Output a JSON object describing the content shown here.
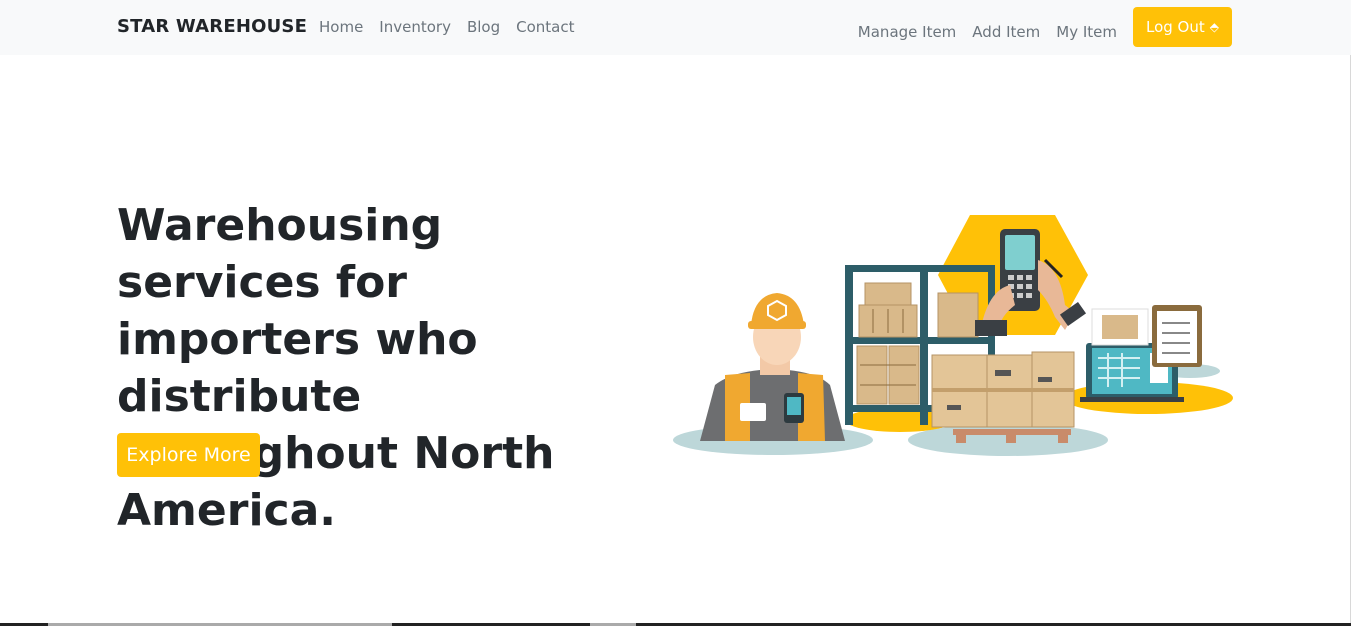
{
  "nav": {
    "brand": "STAR WAREHOUSE",
    "left_links": [
      "Home",
      "Inventory",
      "Blog",
      "Contact"
    ],
    "right_links": [
      "Manage Item",
      "Add Item",
      "My Item"
    ],
    "logout_label": "Log Out",
    "logout_icon": "sign-out-icon"
  },
  "hero": {
    "title": "Warehousing services for importers who distribute throughout North America.",
    "cta_label": "Explore More",
    "illustration": "warehouse-worker-illustration"
  },
  "colors": {
    "accent": "#ffc107",
    "navbar_bg": "#f8f9fa",
    "text_dark": "#212529",
    "nav_link": "#6c757d"
  }
}
